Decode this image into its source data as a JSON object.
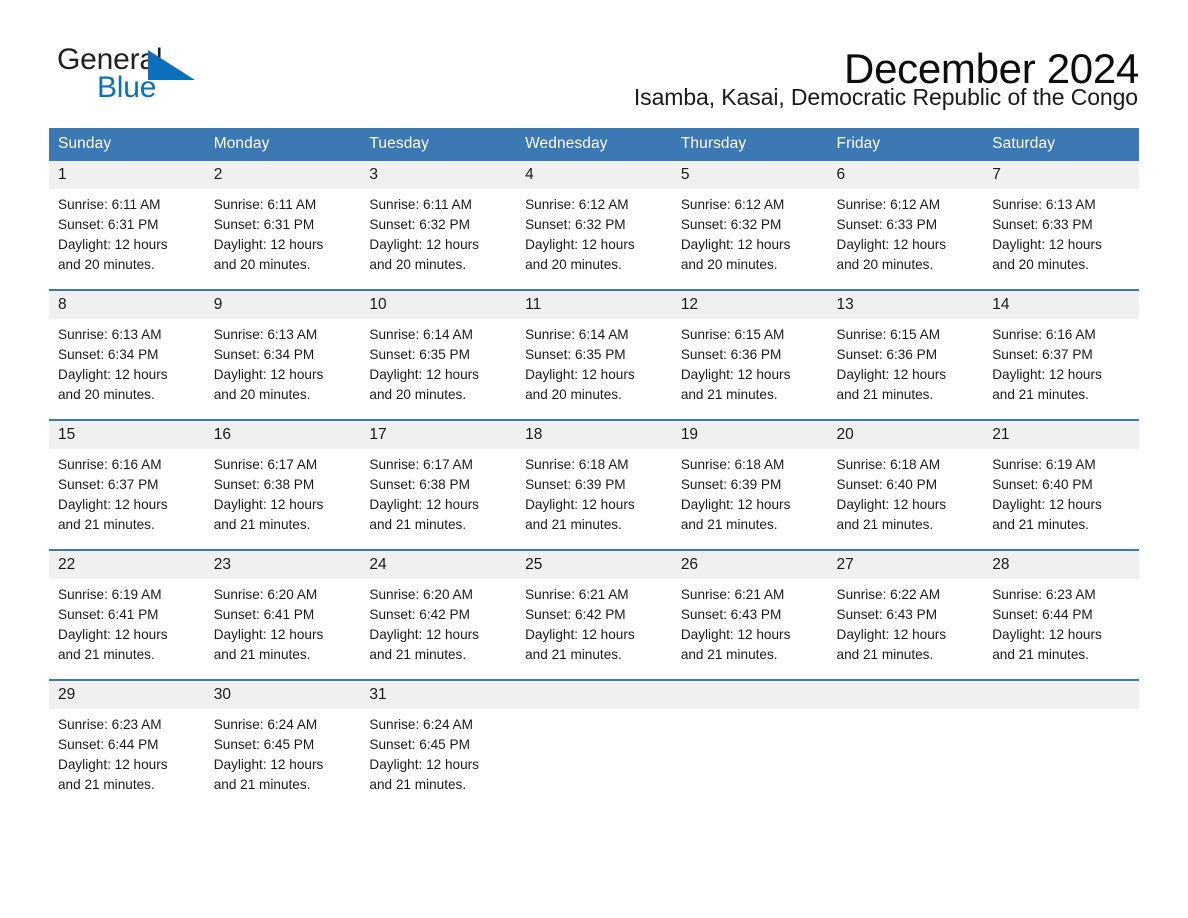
{
  "brand": {
    "name_part1": "General",
    "name_part2": "Blue",
    "accent_color": "#0b6fba",
    "triangle_icon": "triangle-icon"
  },
  "header": {
    "month_title": "December 2024",
    "location": "Isamba, Kasai, Democratic Republic of the Congo"
  },
  "calendar": {
    "header_color": "#3b78b4",
    "daynum_bg": "#f0f0f0",
    "weekdays": [
      "Sunday",
      "Monday",
      "Tuesday",
      "Wednesday",
      "Thursday",
      "Friday",
      "Saturday"
    ],
    "weeks": [
      [
        {
          "day": "1",
          "sunrise": "Sunrise: 6:11 AM",
          "sunset": "Sunset: 6:31 PM",
          "daylight_line1": "Daylight: 12 hours",
          "daylight_line2": "and 20 minutes."
        },
        {
          "day": "2",
          "sunrise": "Sunrise: 6:11 AM",
          "sunset": "Sunset: 6:31 PM",
          "daylight_line1": "Daylight: 12 hours",
          "daylight_line2": "and 20 minutes."
        },
        {
          "day": "3",
          "sunrise": "Sunrise: 6:11 AM",
          "sunset": "Sunset: 6:32 PM",
          "daylight_line1": "Daylight: 12 hours",
          "daylight_line2": "and 20 minutes."
        },
        {
          "day": "4",
          "sunrise": "Sunrise: 6:12 AM",
          "sunset": "Sunset: 6:32 PM",
          "daylight_line1": "Daylight: 12 hours",
          "daylight_line2": "and 20 minutes."
        },
        {
          "day": "5",
          "sunrise": "Sunrise: 6:12 AM",
          "sunset": "Sunset: 6:32 PM",
          "daylight_line1": "Daylight: 12 hours",
          "daylight_line2": "and 20 minutes."
        },
        {
          "day": "6",
          "sunrise": "Sunrise: 6:12 AM",
          "sunset": "Sunset: 6:33 PM",
          "daylight_line1": "Daylight: 12 hours",
          "daylight_line2": "and 20 minutes."
        },
        {
          "day": "7",
          "sunrise": "Sunrise: 6:13 AM",
          "sunset": "Sunset: 6:33 PM",
          "daylight_line1": "Daylight: 12 hours",
          "daylight_line2": "and 20 minutes."
        }
      ],
      [
        {
          "day": "8",
          "sunrise": "Sunrise: 6:13 AM",
          "sunset": "Sunset: 6:34 PM",
          "daylight_line1": "Daylight: 12 hours",
          "daylight_line2": "and 20 minutes."
        },
        {
          "day": "9",
          "sunrise": "Sunrise: 6:13 AM",
          "sunset": "Sunset: 6:34 PM",
          "daylight_line1": "Daylight: 12 hours",
          "daylight_line2": "and 20 minutes."
        },
        {
          "day": "10",
          "sunrise": "Sunrise: 6:14 AM",
          "sunset": "Sunset: 6:35 PM",
          "daylight_line1": "Daylight: 12 hours",
          "daylight_line2": "and 20 minutes."
        },
        {
          "day": "11",
          "sunrise": "Sunrise: 6:14 AM",
          "sunset": "Sunset: 6:35 PM",
          "daylight_line1": "Daylight: 12 hours",
          "daylight_line2": "and 20 minutes."
        },
        {
          "day": "12",
          "sunrise": "Sunrise: 6:15 AM",
          "sunset": "Sunset: 6:36 PM",
          "daylight_line1": "Daylight: 12 hours",
          "daylight_line2": "and 21 minutes."
        },
        {
          "day": "13",
          "sunrise": "Sunrise: 6:15 AM",
          "sunset": "Sunset: 6:36 PM",
          "daylight_line1": "Daylight: 12 hours",
          "daylight_line2": "and 21 minutes."
        },
        {
          "day": "14",
          "sunrise": "Sunrise: 6:16 AM",
          "sunset": "Sunset: 6:37 PM",
          "daylight_line1": "Daylight: 12 hours",
          "daylight_line2": "and 21 minutes."
        }
      ],
      [
        {
          "day": "15",
          "sunrise": "Sunrise: 6:16 AM",
          "sunset": "Sunset: 6:37 PM",
          "daylight_line1": "Daylight: 12 hours",
          "daylight_line2": "and 21 minutes."
        },
        {
          "day": "16",
          "sunrise": "Sunrise: 6:17 AM",
          "sunset": "Sunset: 6:38 PM",
          "daylight_line1": "Daylight: 12 hours",
          "daylight_line2": "and 21 minutes."
        },
        {
          "day": "17",
          "sunrise": "Sunrise: 6:17 AM",
          "sunset": "Sunset: 6:38 PM",
          "daylight_line1": "Daylight: 12 hours",
          "daylight_line2": "and 21 minutes."
        },
        {
          "day": "18",
          "sunrise": "Sunrise: 6:18 AM",
          "sunset": "Sunset: 6:39 PM",
          "daylight_line1": "Daylight: 12 hours",
          "daylight_line2": "and 21 minutes."
        },
        {
          "day": "19",
          "sunrise": "Sunrise: 6:18 AM",
          "sunset": "Sunset: 6:39 PM",
          "daylight_line1": "Daylight: 12 hours",
          "daylight_line2": "and 21 minutes."
        },
        {
          "day": "20",
          "sunrise": "Sunrise: 6:18 AM",
          "sunset": "Sunset: 6:40 PM",
          "daylight_line1": "Daylight: 12 hours",
          "daylight_line2": "and 21 minutes."
        },
        {
          "day": "21",
          "sunrise": "Sunrise: 6:19 AM",
          "sunset": "Sunset: 6:40 PM",
          "daylight_line1": "Daylight: 12 hours",
          "daylight_line2": "and 21 minutes."
        }
      ],
      [
        {
          "day": "22",
          "sunrise": "Sunrise: 6:19 AM",
          "sunset": "Sunset: 6:41 PM",
          "daylight_line1": "Daylight: 12 hours",
          "daylight_line2": "and 21 minutes."
        },
        {
          "day": "23",
          "sunrise": "Sunrise: 6:20 AM",
          "sunset": "Sunset: 6:41 PM",
          "daylight_line1": "Daylight: 12 hours",
          "daylight_line2": "and 21 minutes."
        },
        {
          "day": "24",
          "sunrise": "Sunrise: 6:20 AM",
          "sunset": "Sunset: 6:42 PM",
          "daylight_line1": "Daylight: 12 hours",
          "daylight_line2": "and 21 minutes."
        },
        {
          "day": "25",
          "sunrise": "Sunrise: 6:21 AM",
          "sunset": "Sunset: 6:42 PM",
          "daylight_line1": "Daylight: 12 hours",
          "daylight_line2": "and 21 minutes."
        },
        {
          "day": "26",
          "sunrise": "Sunrise: 6:21 AM",
          "sunset": "Sunset: 6:43 PM",
          "daylight_line1": "Daylight: 12 hours",
          "daylight_line2": "and 21 minutes."
        },
        {
          "day": "27",
          "sunrise": "Sunrise: 6:22 AM",
          "sunset": "Sunset: 6:43 PM",
          "daylight_line1": "Daylight: 12 hours",
          "daylight_line2": "and 21 minutes."
        },
        {
          "day": "28",
          "sunrise": "Sunrise: 6:23 AM",
          "sunset": "Sunset: 6:44 PM",
          "daylight_line1": "Daylight: 12 hours",
          "daylight_line2": "and 21 minutes."
        }
      ],
      [
        {
          "day": "29",
          "sunrise": "Sunrise: 6:23 AM",
          "sunset": "Sunset: 6:44 PM",
          "daylight_line1": "Daylight: 12 hours",
          "daylight_line2": "and 21 minutes."
        },
        {
          "day": "30",
          "sunrise": "Sunrise: 6:24 AM",
          "sunset": "Sunset: 6:45 PM",
          "daylight_line1": "Daylight: 12 hours",
          "daylight_line2": "and 21 minutes."
        },
        {
          "day": "31",
          "sunrise": "Sunrise: 6:24 AM",
          "sunset": "Sunset: 6:45 PM",
          "daylight_line1": "Daylight: 12 hours",
          "daylight_line2": "and 21 minutes."
        },
        {
          "day": "",
          "sunrise": "",
          "sunset": "",
          "daylight_line1": "",
          "daylight_line2": ""
        },
        {
          "day": "",
          "sunrise": "",
          "sunset": "",
          "daylight_line1": "",
          "daylight_line2": ""
        },
        {
          "day": "",
          "sunrise": "",
          "sunset": "",
          "daylight_line1": "",
          "daylight_line2": ""
        },
        {
          "day": "",
          "sunrise": "",
          "sunset": "",
          "daylight_line1": "",
          "daylight_line2": ""
        }
      ]
    ]
  }
}
